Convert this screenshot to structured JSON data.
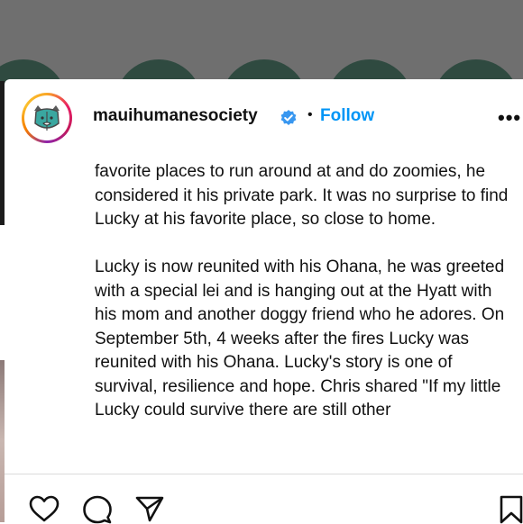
{
  "post": {
    "username": "mauihumanesociety",
    "separator": "•",
    "follow_label": "Follow",
    "more_label": "•••",
    "caption": [
      "favorite places to run around at and do zoomies, he considered it his private park. It was no surprise to find Lucky at his favorite place, so close to home.",
      "Lucky is now reunited with his Ohana, he was greeted with a special lei and is hanging out at the Hyatt with his mom and another doggy friend who he adores. On September 5th, 4 weeks after the fires Lucky was reunited with his Ohana. Lucky's story is one of survival, resilience and hope. Chris shared \"If my little Lucky could survive there are still other"
    ]
  },
  "icons": {
    "verified": "verified-badge-icon",
    "like": "heart-icon",
    "comment": "comment-icon",
    "share": "send-icon",
    "save": "bookmark-icon"
  },
  "colors": {
    "follow": "#0095f6",
    "verified": "#3897f0",
    "background_overlay": "#6f6f6f"
  }
}
